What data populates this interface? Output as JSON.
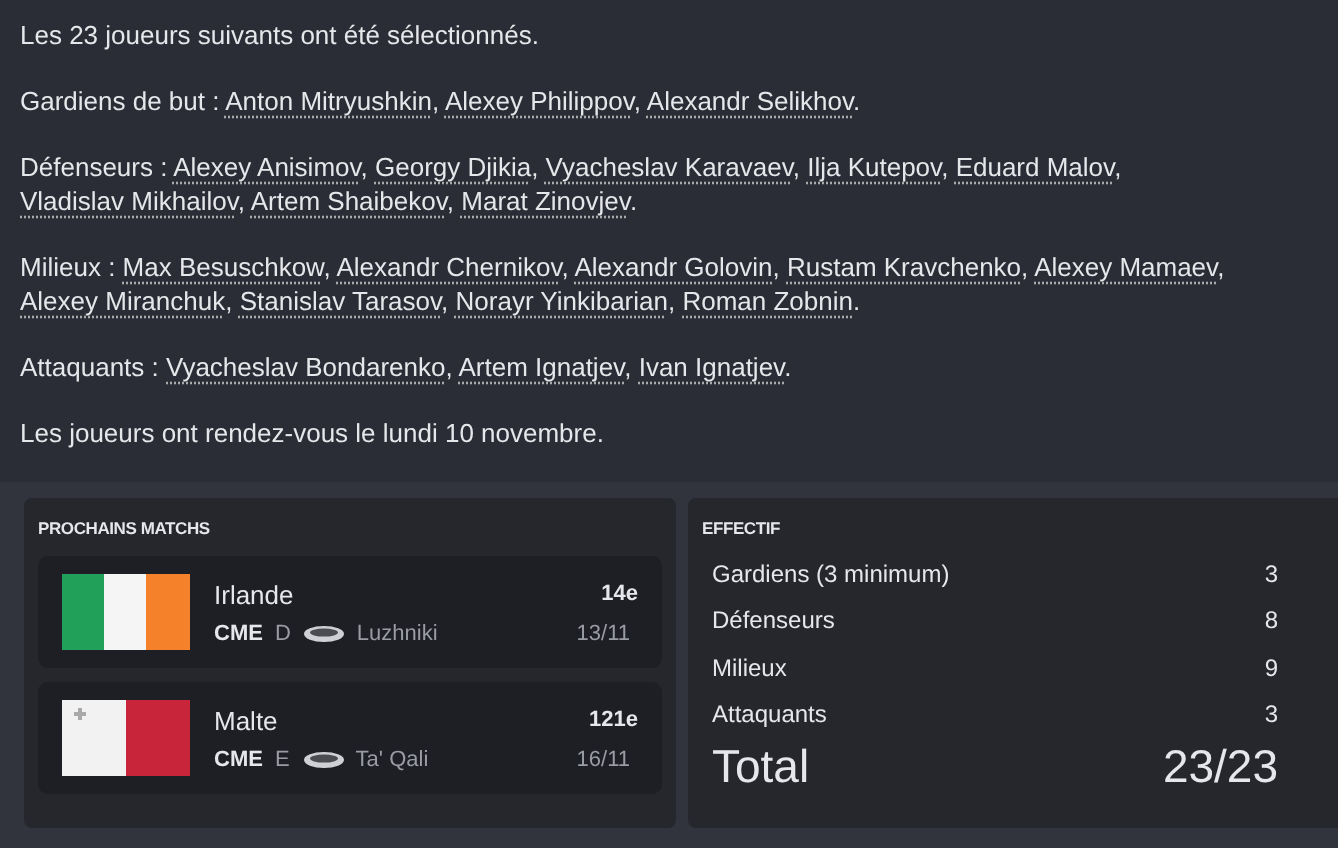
{
  "message": {
    "intro": "Les 23 joueurs suivants ont été sélectionnés.",
    "separator": ", ",
    "end": ".",
    "groups": [
      {
        "label": "Gardiens de but :",
        "players": [
          "Anton Mitryushkin",
          "Alexey Philippov",
          "Alexandr Selikhov"
        ]
      },
      {
        "label": "Défenseurs :",
        "players": [
          "Alexey Anisimov",
          "Georgy Djikia",
          "Vyacheslav Karavaev",
          "Ilja Kutepov",
          "Eduard Malov",
          "Vladislav Mikhailov",
          "Artem Shaibekov",
          "Marat Zinovjev"
        ]
      },
      {
        "label": "Milieux :",
        "players": [
          "Max Besuschkow",
          "Alexandr Chernikov",
          "Alexandr Golovin",
          "Rustam Kravchenko",
          "Alexey Mamaev",
          "Alexey Miranchuk",
          "Stanislav Tarasov",
          "Norayr Yinkibarian",
          "Roman Zobnin"
        ]
      },
      {
        "label": "Attaquants :",
        "players": [
          "Vyacheslav Bondarenko",
          "Artem Ignatjev",
          "Ivan Ignatjev"
        ]
      }
    ],
    "outro": "Les joueurs ont rendez-vous le lundi 10 novembre."
  },
  "next_matches": {
    "title": "PROCHAINS MATCHS",
    "matches": [
      {
        "kind": "ireland",
        "team": "Irlande",
        "rank": "14e",
        "competition": "CME",
        "venue_code": "D",
        "stadium": "Luzhniki",
        "date": "13/11"
      },
      {
        "kind": "malta",
        "team": "Malte",
        "rank": "121e",
        "competition": "CME",
        "venue_code": "E",
        "stadium": "Ta' Qali",
        "date": "16/11"
      }
    ]
  },
  "squad": {
    "title": "EFFECTIF",
    "rows": [
      {
        "label": "Gardiens (3 minimum)",
        "count": "3"
      },
      {
        "label": "Défenseurs",
        "count": "8"
      },
      {
        "label": "Milieux",
        "count": "9"
      },
      {
        "label": "Attaquants",
        "count": "3"
      }
    ],
    "total_label": "Total",
    "total_value": "23/23"
  }
}
